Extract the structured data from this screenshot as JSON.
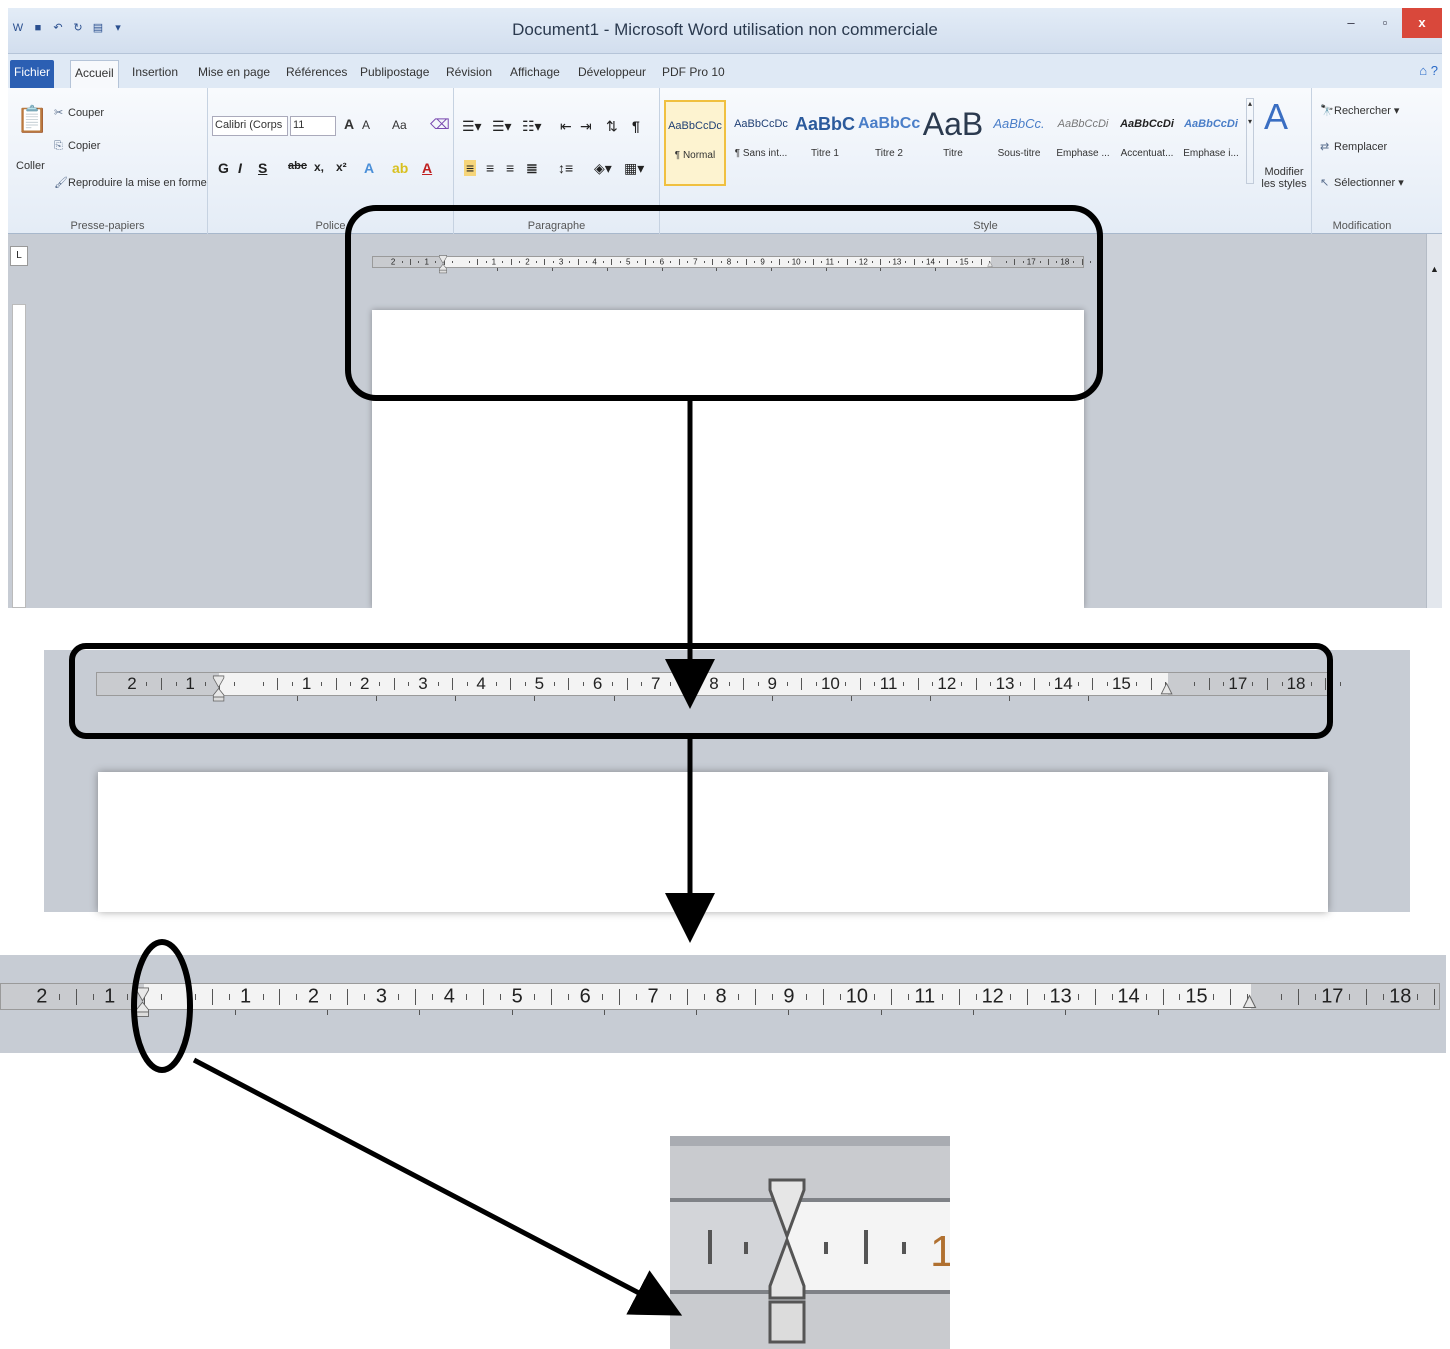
{
  "window": {
    "title": "Document1 - Microsoft Word utilisation non commerciale",
    "qat_icons": [
      "word-logo-icon",
      "save-icon",
      "undo-icon",
      "redo-icon",
      "quick-print-icon",
      "qat-dropdown-icon"
    ],
    "controls": {
      "minimize": "–",
      "restore": "▫",
      "close": "x"
    }
  },
  "tabs": [
    "Fichier",
    "Accueil",
    "Insertion",
    "Mise en page",
    "Références",
    "Publipostage",
    "Révision",
    "Affichage",
    "Développeur",
    "PDF Pro 10"
  ],
  "ribbon": {
    "clipboard": {
      "paste": "Coller",
      "cut": "Couper",
      "copy": "Copier",
      "format_painter": "Reproduire la mise en forme",
      "label": "Presse-papiers"
    },
    "font": {
      "name": "Calibri (Corps",
      "size": "11",
      "bold": "G",
      "italic": "I",
      "underline": "S",
      "strike": "abc",
      "subscript": "x,",
      "superscript": "x²",
      "grow": "A",
      "shrink": "A",
      "case": "Aa",
      "label": "Police"
    },
    "paragraph": {
      "label": "Paragraphe"
    },
    "styles": {
      "label": "Style",
      "items": [
        {
          "sample": "AaBbCcDc",
          "name": "¶ Normal"
        },
        {
          "sample": "AaBbCcDc",
          "name": "¶ Sans int..."
        },
        {
          "sample": "AaBbC",
          "name": "Titre 1"
        },
        {
          "sample": "AaBbCc",
          "name": "Titre 2"
        },
        {
          "sample": "AaB",
          "name": "Titre"
        },
        {
          "sample": "AaBbCc.",
          "name": "Sous-titre"
        },
        {
          "sample": "AaBbCcDi",
          "name": "Emphase ..."
        },
        {
          "sample": "AaBbCcDi",
          "name": "Accentuat..."
        },
        {
          "sample": "AaBbCcDi",
          "name": "Emphase i..."
        }
      ],
      "change_styles": "Modifier les styles"
    },
    "editing": {
      "find": "Rechercher",
      "replace": "Remplacer",
      "select": "Sélectionner",
      "label": "Modification"
    }
  },
  "ruler": {
    "left_numbers": [
      "2",
      "1"
    ],
    "right_numbers": [
      "1",
      "2",
      "3",
      "4",
      "5",
      "6",
      "7",
      "8",
      "9",
      "10",
      "11",
      "12",
      "13",
      "14",
      "15"
    ],
    "margin_numbers": [
      "17",
      "18"
    ],
    "zoom_text": "1"
  },
  "colors": {
    "ribbon_tab_active": "#2b5fb3",
    "window_close": "#d9483b",
    "annotation": "#000000"
  }
}
